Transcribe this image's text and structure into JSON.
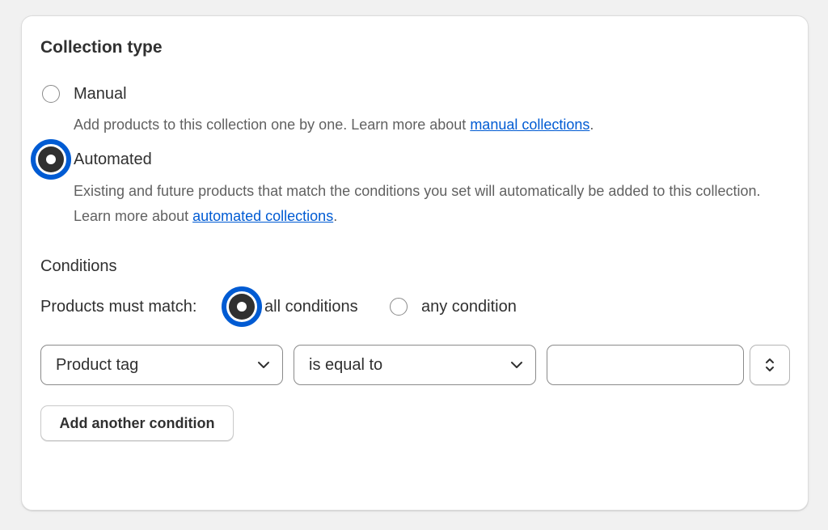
{
  "card": {
    "title": "Collection type",
    "options": [
      {
        "label": "Manual",
        "selected": false,
        "help_prefix": "Add products to this collection one by one. Learn more about ",
        "help_link": "manual collections",
        "help_suffix": "."
      },
      {
        "label": "Automated",
        "selected": true,
        "help_prefix": "Existing and future products that match the conditions you set will automatically be added to this collection. Learn more about ",
        "help_link": "automated collections",
        "help_suffix": "."
      }
    ],
    "conditions": {
      "heading": "Conditions",
      "match_label": "Products must match:",
      "match_options": [
        {
          "label": "all conditions",
          "selected": true
        },
        {
          "label": "any condition",
          "selected": false
        }
      ],
      "rule": {
        "field": "Product tag",
        "operator": "is equal to",
        "value": ""
      },
      "add_button": "Add another condition"
    }
  },
  "icons": {
    "select_caret": "chevron-down-icon",
    "stepper": "select-updown-icon"
  },
  "colors": {
    "focus_ring": "#005bd3",
    "link": "#005bd3",
    "background": "#f1f1f1"
  }
}
